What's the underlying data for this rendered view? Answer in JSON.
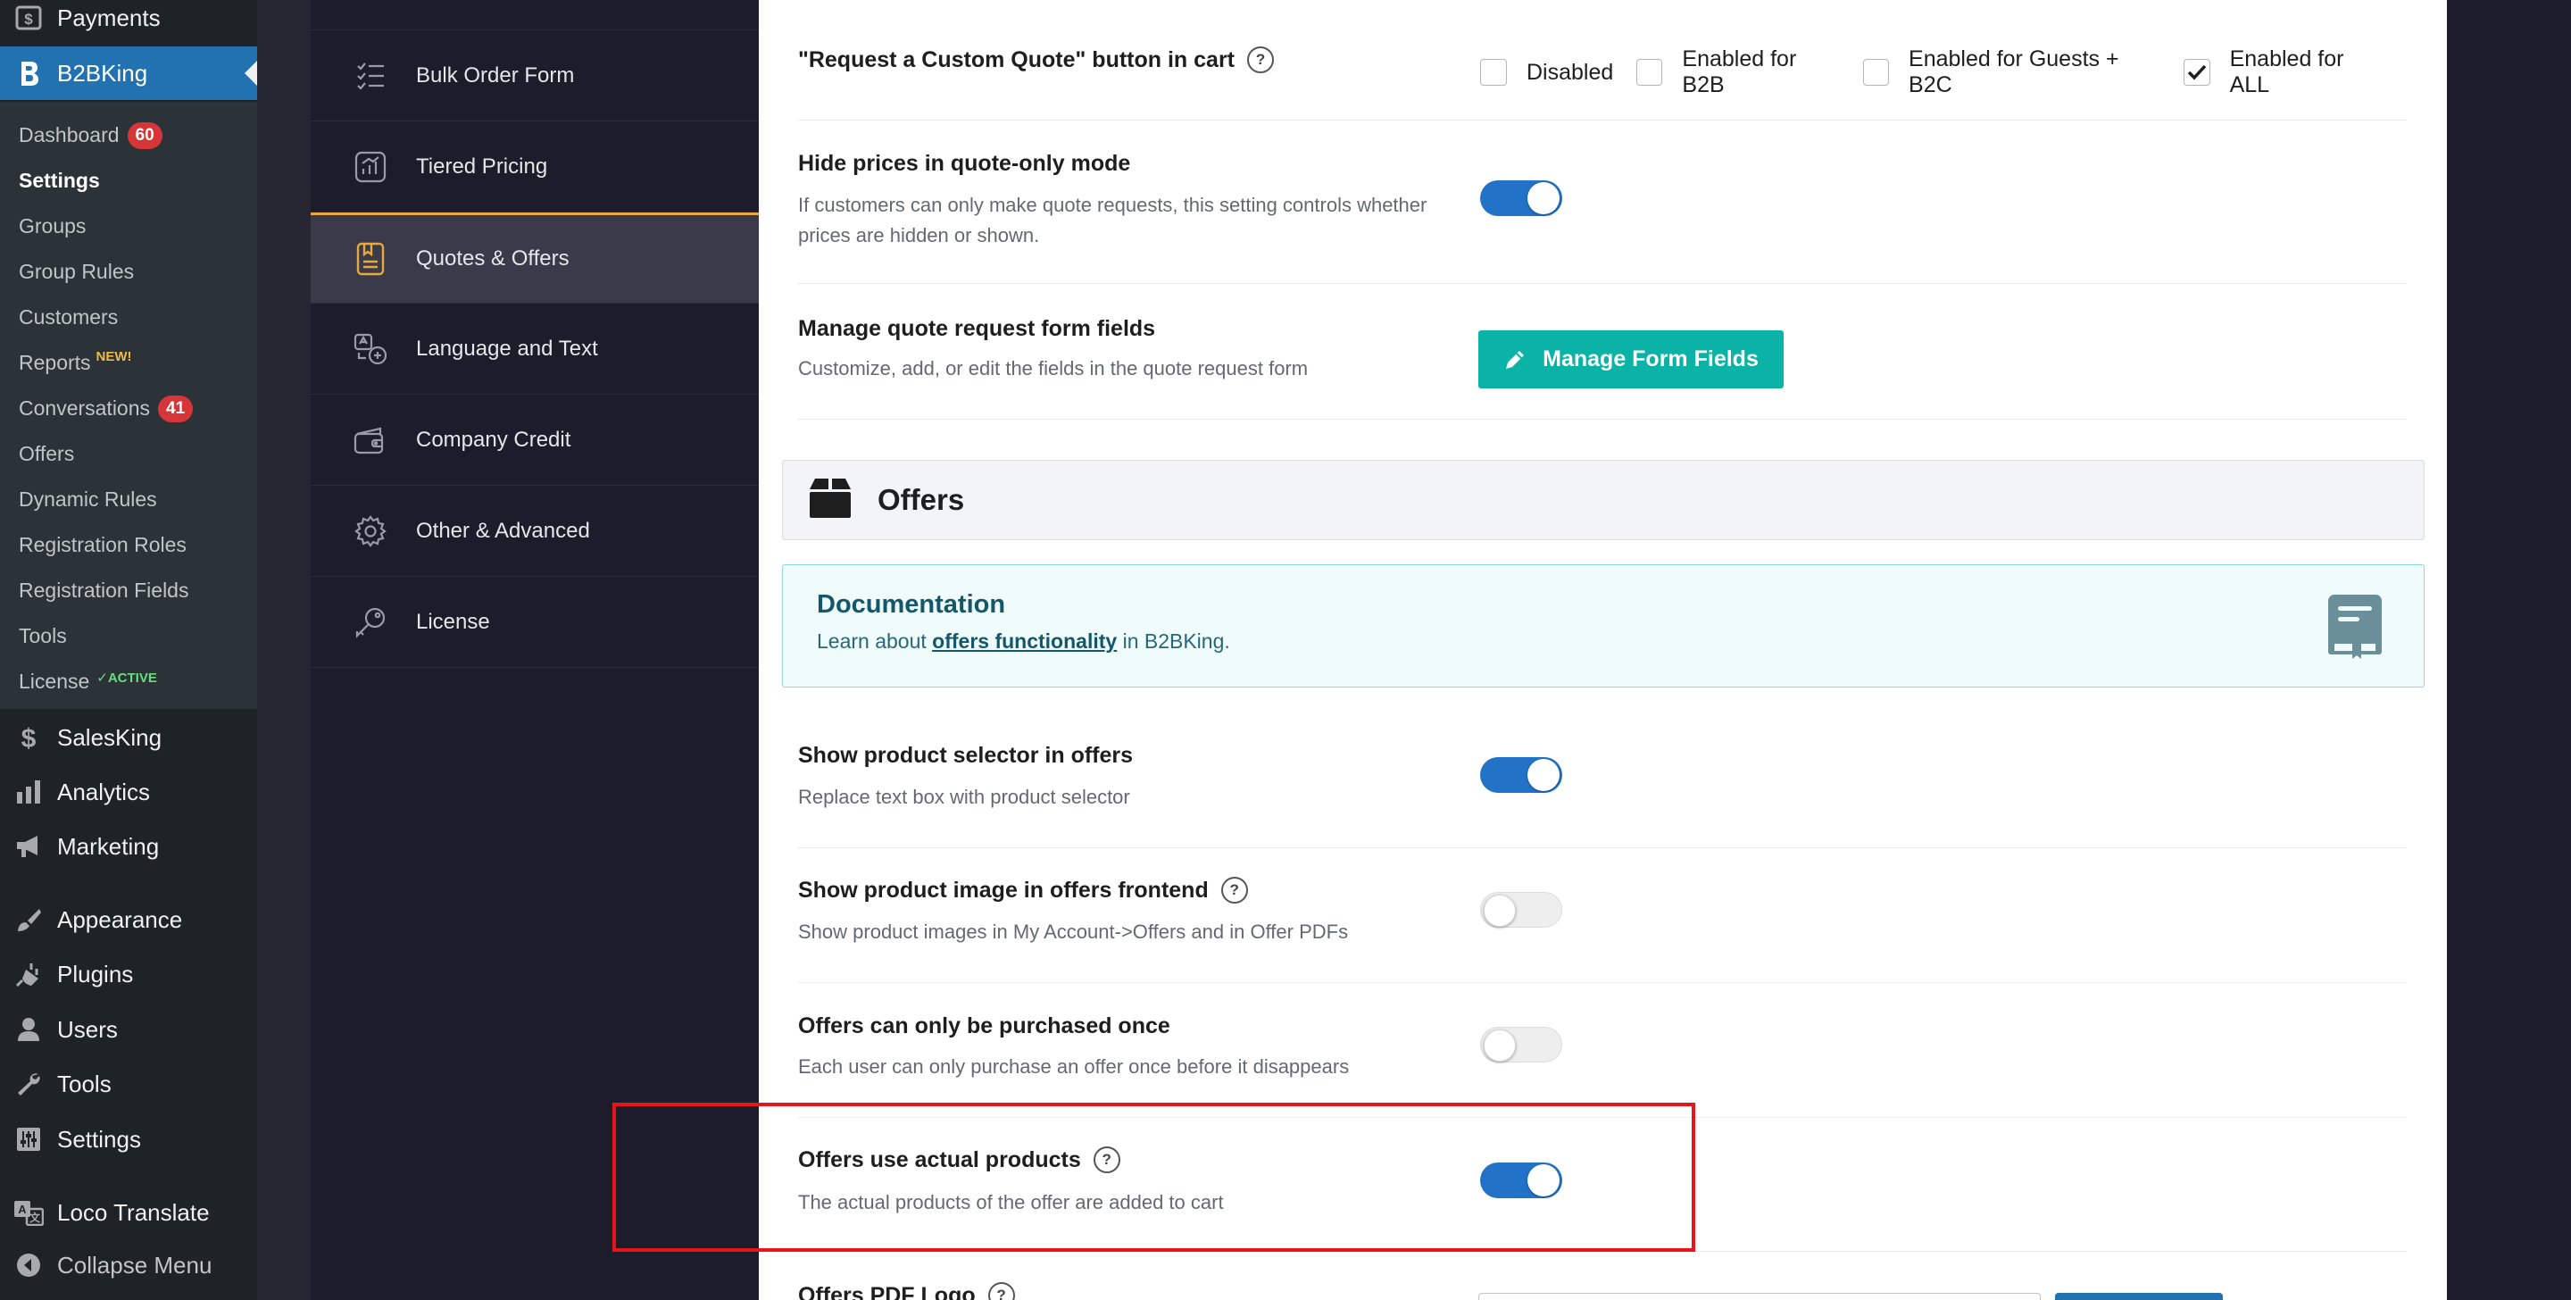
{
  "wp_menu": {
    "payments": "Payments",
    "b2bking": "B2BKing",
    "submenu": [
      {
        "label": "Dashboard",
        "badge": "60"
      },
      {
        "label": "Settings",
        "current": true
      },
      {
        "label": "Groups"
      },
      {
        "label": "Group Rules"
      },
      {
        "label": "Customers"
      },
      {
        "label": "Reports",
        "tag": "NEW!"
      },
      {
        "label": "Conversations",
        "badge": "41"
      },
      {
        "label": "Offers"
      },
      {
        "label": "Dynamic Rules"
      },
      {
        "label": "Registration Roles"
      },
      {
        "label": "Registration Fields"
      },
      {
        "label": "Tools"
      },
      {
        "label": "License",
        "tag": "✓ACTIVE"
      }
    ],
    "salesking": "SalesKing",
    "analytics": "Analytics",
    "marketing": "Marketing",
    "appearance": "Appearance",
    "plugins": "Plugins",
    "users": "Users",
    "tools": "Tools",
    "settings": "Settings",
    "loco_translate": "Loco Translate",
    "collapse_menu": "Collapse Menu"
  },
  "plugin_nav": {
    "items": [
      {
        "label": "Bulk Order Form",
        "icon": "checklist-icon"
      },
      {
        "label": "Tiered Pricing",
        "icon": "chart-icon"
      },
      {
        "label": "Quotes & Offers",
        "icon": "document-icon",
        "active": true
      },
      {
        "label": "Language and Text",
        "icon": "language-icon"
      },
      {
        "label": "Company Credit",
        "icon": "wallet-icon"
      },
      {
        "label": "Other & Advanced",
        "icon": "gear-icon"
      },
      {
        "label": "License",
        "icon": "key-icon"
      }
    ]
  },
  "settings": {
    "custom_quote": {
      "label": "\"Request a Custom Quote\" button in cart",
      "options": [
        "Disabled",
        "Enabled for B2B",
        "Enabled for Guests + B2C",
        "Enabled for ALL"
      ],
      "selected": "Enabled for ALL"
    },
    "hide_prices": {
      "label": "Hide prices in quote-only mode",
      "desc": "If customers can only make quote requests, this setting controls whether prices are hidden or shown.",
      "enabled": true
    },
    "manage_fields": {
      "label": "Manage quote request form fields",
      "desc": "Customize, add, or edit the fields in the quote request form",
      "button": "Manage Form Fields"
    },
    "offers_section": {
      "title": "Offers"
    },
    "documentation": {
      "title": "Documentation",
      "text_before": "Learn about ",
      "link": "offers functionality",
      "text_after": " in B2BKing."
    },
    "product_selector": {
      "label": "Show product selector in offers",
      "desc": "Replace text box with product selector",
      "enabled": true
    },
    "product_image": {
      "label": "Show product image in offers frontend",
      "desc": "Show product images in My Account->Offers and in Offer PDFs",
      "enabled": false
    },
    "purchase_once": {
      "label": "Offers can only be purchased once",
      "desc": "Each user can only purchase an offer once before it disappears",
      "enabled": false
    },
    "actual_products": {
      "label": "Offers use actual products",
      "desc": "The actual products of the offer are added to cart",
      "enabled": true
    },
    "pdf_logo": {
      "label": "Offers PDF Logo"
    }
  },
  "help_glyph": "?",
  "colors": {
    "accent": "#2273c8",
    "teal": "#0ab3a5",
    "highlight": "#e8141a",
    "nav_active": "#e8a93a"
  }
}
